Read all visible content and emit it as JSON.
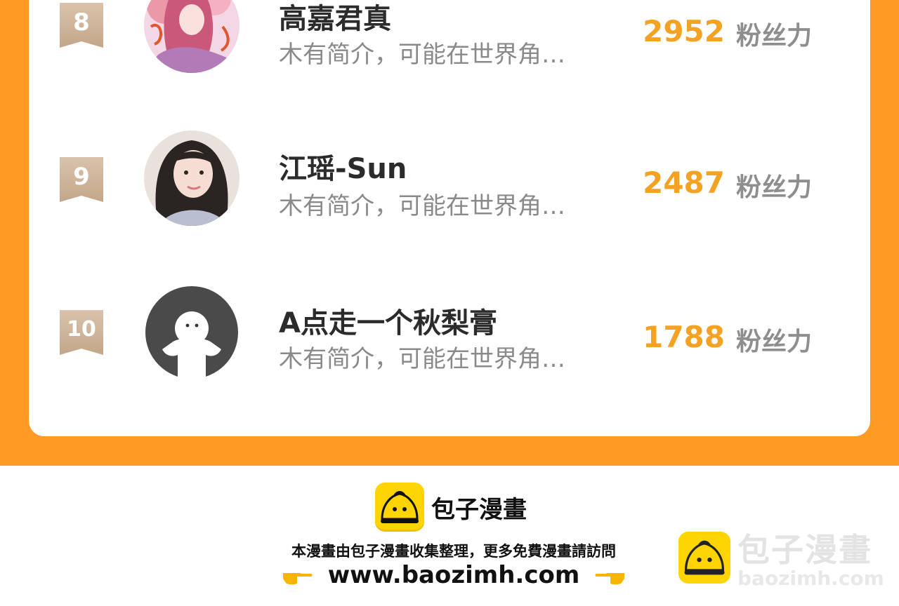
{
  "colors": {
    "frame_orange": "#ff9a24",
    "score_orange": "#f3a223",
    "rank_badge": "#cdb296",
    "brand_yellow": "#ffd400"
  },
  "ranking": [
    {
      "rank": "8",
      "name": "高嘉君真",
      "bio": "木有简介，可能在世界角…",
      "score": "2952",
      "unit": "粉丝力",
      "avatar_icon": "anime-girl-avatar"
    },
    {
      "rank": "9",
      "name": "江瑶-Sun",
      "bio": "木有简介，可能在世界角…",
      "score": "2487",
      "unit": "粉丝力",
      "avatar_icon": "photo-girl-avatar"
    },
    {
      "rank": "10",
      "name": "A点走一个秋梨膏",
      "bio": "木有简介，可能在世界角…",
      "score": "1788",
      "unit": "粉丝力",
      "avatar_icon": "default-ghost-avatar"
    }
  ],
  "footer": {
    "brand_name": "包子漫畫",
    "note": "本漫畫由包子漫畫收集整理，更多免費漫畫請訪問",
    "url": "www.baozimh.com",
    "watermark_title": "包子漫畫",
    "watermark_url": "baozimh.com"
  }
}
